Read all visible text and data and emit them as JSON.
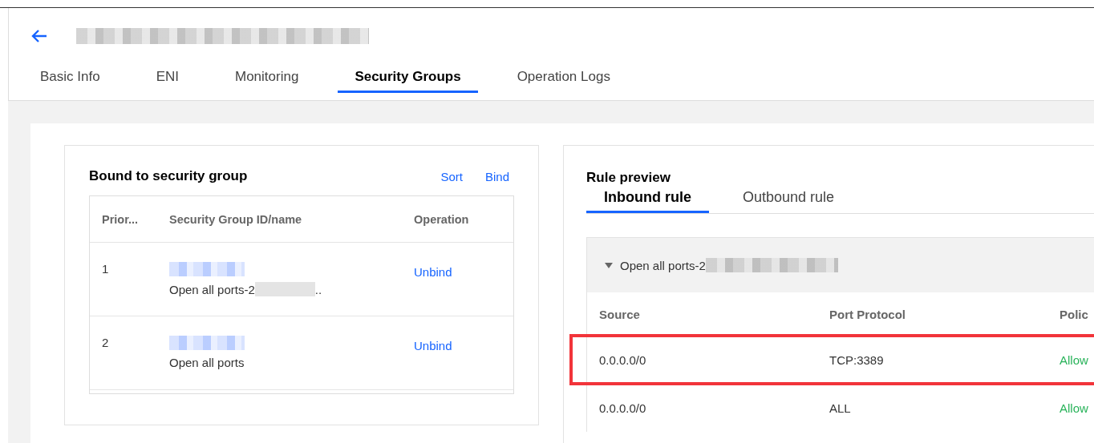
{
  "header": {
    "title_redacted": true
  },
  "tabs": [
    {
      "label": "Basic Info",
      "selected": false
    },
    {
      "label": "ENI",
      "selected": false
    },
    {
      "label": "Monitoring",
      "selected": false
    },
    {
      "label": "Security Groups",
      "selected": true
    },
    {
      "label": "Operation Logs",
      "selected": false
    }
  ],
  "bound_panel": {
    "title": "Bound to security group",
    "actions": [
      "Sort",
      "Bind"
    ],
    "columns": [
      "Prior...",
      "Security Group ID/name",
      "Operation"
    ],
    "rows": [
      {
        "priority": "1",
        "name": "Open all ports-2",
        "name_redacted": true,
        "name_trail": "..",
        "action": "Unbind"
      },
      {
        "priority": "2",
        "name": "Open all ports",
        "name_redacted": false,
        "action": "Unbind"
      }
    ]
  },
  "rule_panel": {
    "title": "Rule preview",
    "tabs": [
      {
        "label": "Inbound rule",
        "selected": true
      },
      {
        "label": "Outbound rule",
        "selected": false
      }
    ],
    "group": {
      "name": "Open all ports-2",
      "expanded": true
    },
    "columns": [
      "Source",
      "Port Protocol",
      "Polic"
    ],
    "rows": [
      {
        "source": "0.0.0.0/0",
        "port": "TCP:3389",
        "policy": "Allow",
        "highlighted": true
      },
      {
        "source": "0.0.0.0/0",
        "port": "ALL",
        "policy": "Allow",
        "highlighted": false
      }
    ]
  }
}
